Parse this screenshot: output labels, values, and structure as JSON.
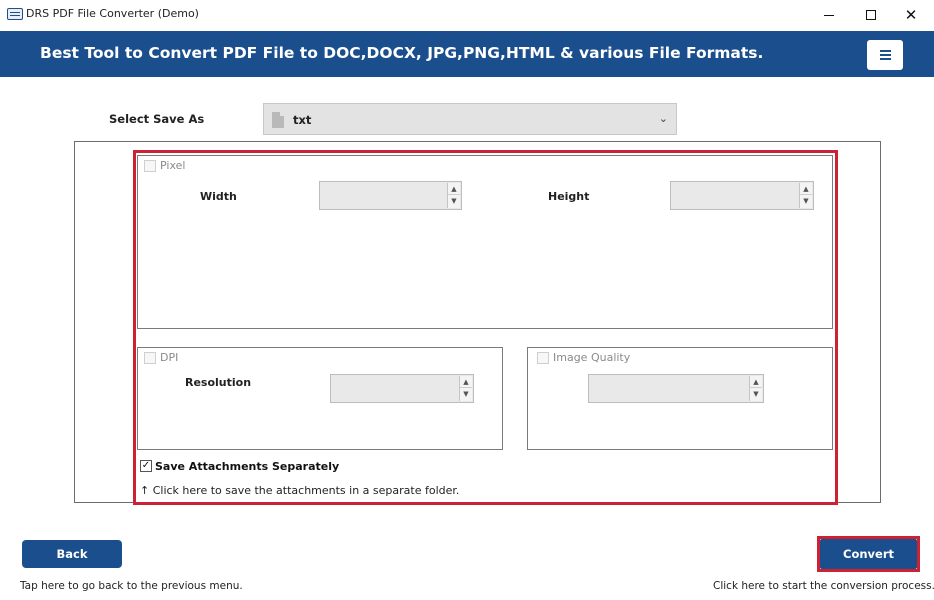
{
  "window": {
    "title": "DRS PDF File Converter (Demo)",
    "minimize_icon": "minimize-icon",
    "maximize_icon": "maximize-icon",
    "close_icon": "close-icon",
    "close_glyph": "✕"
  },
  "header": {
    "title": "Best Tool to Convert PDF File to DOC,DOCX, JPG,PNG,HTML & various File Formats.",
    "background": "#1b4e8c",
    "menu_icon": "hamburger-menu-icon"
  },
  "save_as": {
    "label": "Select Save As",
    "selected": "txt",
    "chevron": "⌄"
  },
  "pixel": {
    "label": "Pixel",
    "checked": false,
    "width_label": "Width",
    "height_label": "Height",
    "width_value": "",
    "height_value": ""
  },
  "dpi": {
    "label": "DPI",
    "checked": false,
    "resolution_label": "Resolution",
    "resolution_value": ""
  },
  "image_quality": {
    "label": "Image Quality",
    "checked": false,
    "value": ""
  },
  "attachments": {
    "label": "Save Attachments Separately",
    "checked": true,
    "check_glyph": "✓",
    "hint": "↑ Click here to save the attachments in a separate folder."
  },
  "footer": {
    "back_label": "Back",
    "back_hint": "Tap here to go back to the previous menu.",
    "convert_label": "Convert",
    "convert_hint": "Click here to start the conversion process."
  },
  "colors": {
    "accent": "#1b4e8c",
    "highlight": "#cc2233"
  }
}
